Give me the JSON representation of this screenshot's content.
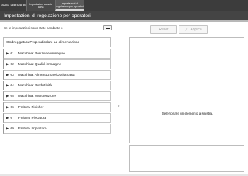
{
  "tabs": {
    "status": "Stato stampante",
    "paper_settings": "Impostazioni vassoio carta",
    "operator_settings": "Impostazioni di regolazione per operatori"
  },
  "header": {
    "title": "Impostazioni di regolazione per operatori"
  },
  "changed_question": "Se le impostazioni sono state cambiate o",
  "buttons": {
    "reset": "Reset",
    "apply": "Applica"
  },
  "selector": {
    "label": "Ombreggiatura:Perpendicolare ad alimentazione"
  },
  "items": [
    {
      "num": "01",
      "label": "Macchina: Posizione immagine"
    },
    {
      "num": "02",
      "label": "Macchina: Qualità immagine"
    },
    {
      "num": "03",
      "label": "Macchina: Alimentazione/Uscita carta"
    },
    {
      "num": "04",
      "label": "Macchina: Produttività"
    },
    {
      "num": "05",
      "label": "Macchina: Manutenzione"
    },
    {
      "num": "06",
      "label": "Finitura: Finisher"
    },
    {
      "num": "07",
      "label": "Finitura: Piegatura"
    },
    {
      "num": "09",
      "label": "Finitura: Impilatore"
    }
  ],
  "right_panel": {
    "message": "Selezionare un elemento a sinistra."
  }
}
